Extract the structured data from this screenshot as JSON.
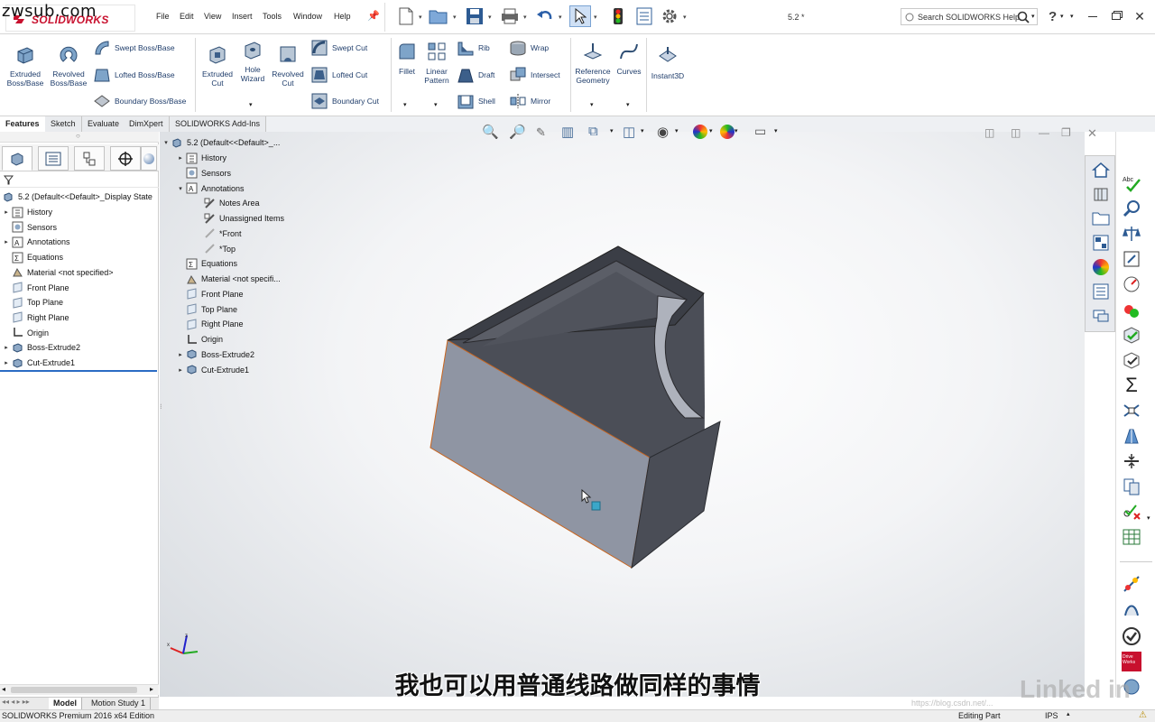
{
  "watermark_top": "zwsub.com",
  "app": {
    "brand": "SOLIDWORKS",
    "document_title": "5.2 *"
  },
  "menu": [
    "File",
    "Edit",
    "View",
    "Insert",
    "Tools",
    "Window",
    "Help"
  ],
  "search": {
    "placeholder": "Search SOLIDWORKS Help"
  },
  "commands": {
    "extruded_boss": "Extruded\nBoss/Base",
    "revolved_boss": "Revolved\nBoss/Base",
    "swept_boss": "Swept Boss/Base",
    "lofted_boss": "Lofted Boss/Base",
    "boundary_boss": "Boundary Boss/Base",
    "extruded_cut": "Extruded\nCut",
    "hole_wizard": "Hole\nWizard",
    "revolved_cut": "Revolved\nCut",
    "swept_cut": "Swept Cut",
    "lofted_cut": "Lofted Cut",
    "boundary_cut": "Boundary Cut",
    "fillet": "Fillet",
    "linear_pattern": "Linear\nPattern",
    "rib": "Rib",
    "draft": "Draft",
    "shell": "Shell",
    "wrap": "Wrap",
    "intersect": "Intersect",
    "mirror": "Mirror",
    "reference_geometry": "Reference\nGeometry",
    "curves": "Curves",
    "instant3d": "Instant3D"
  },
  "tabs": [
    "Features",
    "Sketch",
    "Evaluate",
    "DimXpert",
    "SOLIDWORKS Add-Ins"
  ],
  "left_tree": {
    "root": "5.2  (Default<<Default>_Display State",
    "items": [
      {
        "label": "History",
        "expandable": true,
        "icon": "history-icon"
      },
      {
        "label": "Sensors",
        "expandable": false,
        "icon": "sensor-icon"
      },
      {
        "label": "Annotations",
        "expandable": true,
        "icon": "annotation-icon"
      },
      {
        "label": "Equations",
        "expandable": false,
        "icon": "equation-icon"
      },
      {
        "label": "Material <not specified>",
        "expandable": false,
        "icon": "material-icon"
      },
      {
        "label": "Front Plane",
        "expandable": false,
        "icon": "plane-icon"
      },
      {
        "label": "Top Plane",
        "expandable": false,
        "icon": "plane-icon"
      },
      {
        "label": "Right Plane",
        "expandable": false,
        "icon": "plane-icon"
      },
      {
        "label": "Origin",
        "expandable": false,
        "icon": "origin-icon"
      },
      {
        "label": "Boss-Extrude2",
        "expandable": true,
        "icon": "feature-icon"
      },
      {
        "label": "Cut-Extrude1",
        "expandable": true,
        "icon": "feature-icon"
      }
    ]
  },
  "flyout_tree": {
    "root": "5.2  (Default<<Default>_...",
    "items": [
      {
        "label": "History",
        "expandable": "collapsed",
        "icon": "history-icon"
      },
      {
        "label": "Sensors",
        "expandable": "none",
        "icon": "sensor-icon"
      },
      {
        "label": "Annotations",
        "expandable": "open",
        "icon": "annotation-icon"
      },
      {
        "label": "Notes Area",
        "expandable": "child",
        "icon": "notes-icon"
      },
      {
        "label": "Unassigned Items",
        "expandable": "child",
        "icon": "notes-icon"
      },
      {
        "label": "*Front",
        "expandable": "child",
        "icon": "view-icon"
      },
      {
        "label": "*Top",
        "expandable": "child",
        "icon": "view-icon"
      },
      {
        "label": "Equations",
        "expandable": "none",
        "icon": "equation-icon"
      },
      {
        "label": "Material <not specifi...",
        "expandable": "none",
        "icon": "material-icon"
      },
      {
        "label": "Front Plane",
        "expandable": "none",
        "icon": "plane-icon"
      },
      {
        "label": "Top Plane",
        "expandable": "none",
        "icon": "plane-icon"
      },
      {
        "label": "Right Plane",
        "expandable": "none",
        "icon": "plane-icon"
      },
      {
        "label": "Origin",
        "expandable": "none",
        "icon": "origin-icon"
      },
      {
        "label": "Boss-Extrude2",
        "expandable": "collapsed",
        "icon": "feature-icon"
      },
      {
        "label": "Cut-Extrude1",
        "expandable": "collapsed",
        "icon": "feature-icon"
      }
    ]
  },
  "bottom_tabs": [
    "Model",
    "Motion Study 1"
  ],
  "status": {
    "edition": "SOLIDWORKS Premium 2016 x64 Edition",
    "mode": "Editing Part",
    "units": "IPS"
  },
  "subtitle": "我也可以用普通线路做同样的事情",
  "linkedin": "Linked in",
  "csdn_watermark": "https://blog.csdn.net/...",
  "colors": {
    "accent": "#1f5fb4",
    "model_face": "#8f95a3",
    "model_dark": "#4a4d56",
    "edge_highlight": "#c8641e"
  }
}
